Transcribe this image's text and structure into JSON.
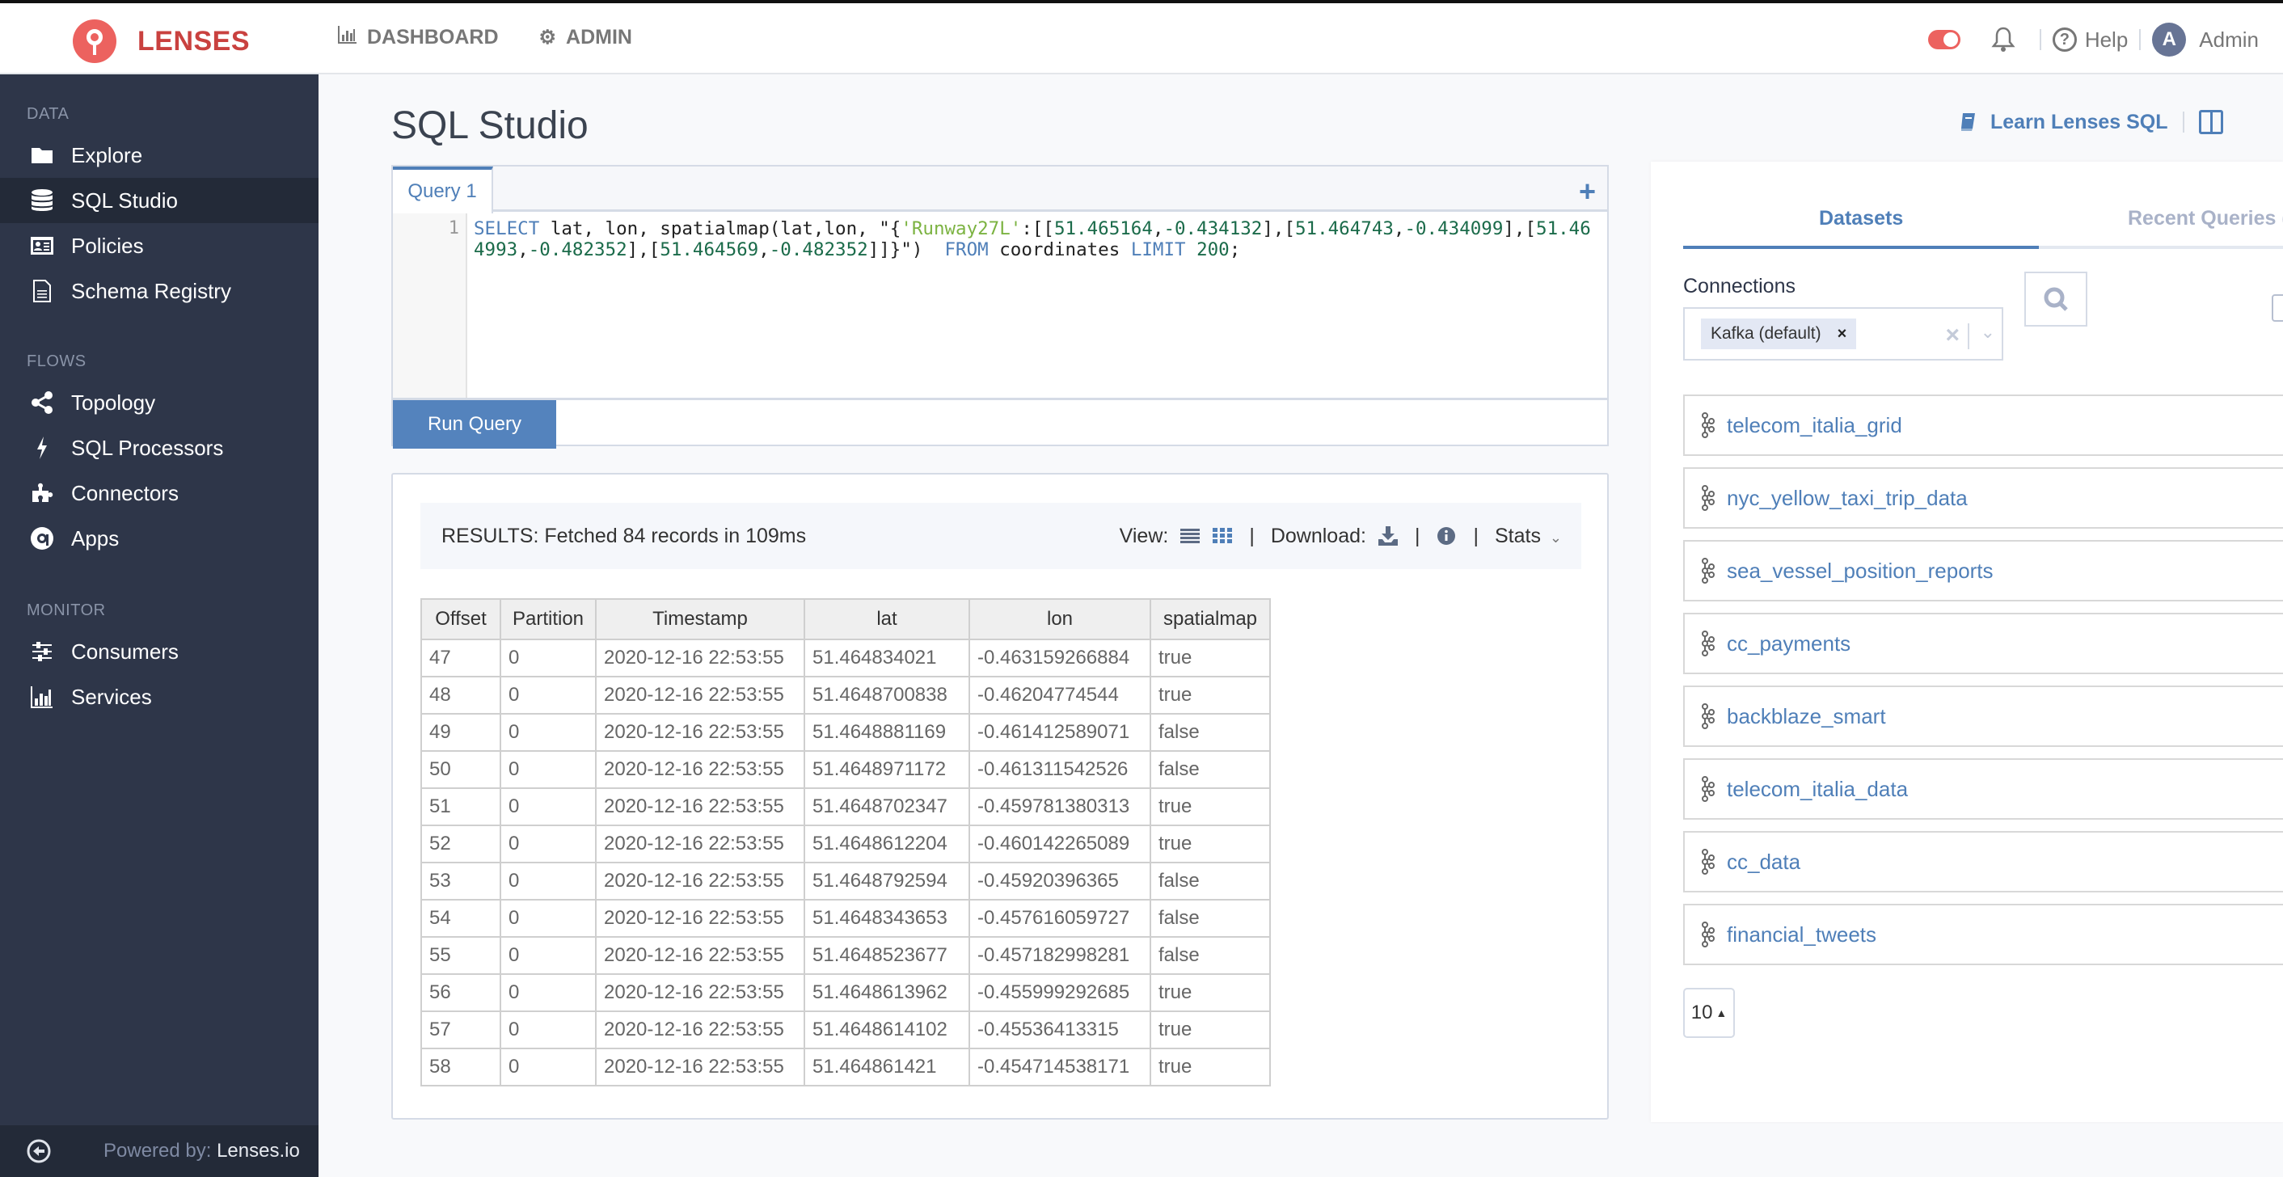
{
  "topbar": {
    "brand": "LENSES",
    "nav": [
      {
        "label": "DASHBOARD",
        "icon": "bar-chart-icon"
      },
      {
        "label": "ADMIN",
        "icon": "gear-icon"
      }
    ],
    "help_label": "Help",
    "avatar_initial": "A",
    "user_name": "Admin",
    "toggle_on": true
  },
  "sidebar": {
    "sections": [
      {
        "title": "DATA",
        "items": [
          {
            "label": "Explore",
            "icon": "folder-icon"
          },
          {
            "label": "SQL Studio",
            "icon": "database-icon",
            "active": true
          },
          {
            "label": "Policies",
            "icon": "id-card-icon"
          },
          {
            "label": "Schema Registry",
            "icon": "document-icon"
          }
        ]
      },
      {
        "title": "FLOWS",
        "items": [
          {
            "label": "Topology",
            "icon": "share-icon"
          },
          {
            "label": "SQL Processors",
            "icon": "bolt-icon"
          },
          {
            "label": "Connectors",
            "icon": "puzzle-icon"
          },
          {
            "label": "Apps",
            "icon": "apps-icon"
          }
        ]
      },
      {
        "title": "MONITOR",
        "items": [
          {
            "label": "Consumers",
            "icon": "sliders-icon"
          },
          {
            "label": "Services",
            "icon": "bar-chart-icon"
          }
        ]
      }
    ],
    "footer": {
      "powered_prefix": "Powered by:",
      "powered_brand": "Lenses.io"
    }
  },
  "main": {
    "title": "SQL Studio",
    "learn_link": "Learn Lenses SQL",
    "query_tab": "Query 1",
    "editor": {
      "line_number": "1",
      "query": "SELECT lat, lon, spatialmap(lat,lon, \"{'Runway27L':[[51.465164,-0.434132],[51.464743,-0.434099],[51.464993,-0.482352],[51.464569,-0.482352]]}\")  FROM coordinates LIMIT 200;"
    },
    "run_button": "Run Query",
    "results": {
      "summary": "RESULTS: Fetched 84 records in 109ms",
      "view_label": "View:",
      "download_label": "Download:",
      "stats_label": "Stats",
      "columns": [
        "Offset",
        "Partition",
        "Timestamp",
        "lat",
        "lon",
        "spatialmap"
      ],
      "rows": [
        [
          "47",
          "0",
          "2020-12-16 22:53:55",
          "51.464834021",
          "-0.463159266884",
          "true"
        ],
        [
          "48",
          "0",
          "2020-12-16 22:53:55",
          "51.4648700838",
          "-0.46204774544",
          "true"
        ],
        [
          "49",
          "0",
          "2020-12-16 22:53:55",
          "51.4648881169",
          "-0.461412589071",
          "false"
        ],
        [
          "50",
          "0",
          "2020-12-16 22:53:55",
          "51.4648971172",
          "-0.461311542526",
          "false"
        ],
        [
          "51",
          "0",
          "2020-12-16 22:53:55",
          "51.4648702347",
          "-0.459781380313",
          "true"
        ],
        [
          "52",
          "0",
          "2020-12-16 22:53:55",
          "51.4648612204",
          "-0.460142265089",
          "true"
        ],
        [
          "53",
          "0",
          "2020-12-16 22:53:55",
          "51.4648792594",
          "-0.45920396365",
          "false"
        ],
        [
          "54",
          "0",
          "2020-12-16 22:53:55",
          "51.4648343653",
          "-0.457616059727",
          "false"
        ],
        [
          "55",
          "0",
          "2020-12-16 22:53:55",
          "51.4648523677",
          "-0.457182998281",
          "false"
        ],
        [
          "56",
          "0",
          "2020-12-16 22:53:55",
          "51.4648613962",
          "-0.455999292685",
          "true"
        ],
        [
          "57",
          "0",
          "2020-12-16 22:53:55",
          "51.4648614102",
          "-0.45536413315",
          "true"
        ],
        [
          "58",
          "0",
          "2020-12-16 22:53:55",
          "51.464861421",
          "-0.454714538171",
          "true"
        ]
      ]
    }
  },
  "right_panel": {
    "tabs": [
      {
        "label": "Datasets",
        "active": true
      },
      {
        "label": "Recent Queries (",
        "active": false
      }
    ],
    "connections_label": "Connections",
    "connection_chip": "Kafka (default)",
    "datasets": [
      "telecom_italia_grid",
      "nyc_yellow_taxi_trip_data",
      "sea_vessel_position_reports",
      "cc_payments",
      "backblaze_smart",
      "telecom_italia_data",
      "cc_data",
      "financial_tweets"
    ],
    "page_size": "10"
  },
  "colors": {
    "brand": "#c9413f",
    "accent": "#4f7fb8",
    "sidebar_bg": "#2e3649",
    "run_button": "#5483bd"
  }
}
